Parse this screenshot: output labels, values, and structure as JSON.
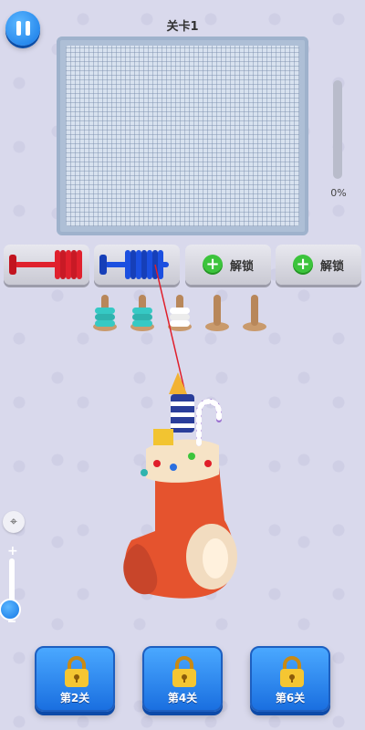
{
  "header": {
    "title": "关卡1"
  },
  "progress": {
    "percent": 0,
    "label": "0%"
  },
  "slots": [
    {
      "type": "spool",
      "color": "#e0212d"
    },
    {
      "type": "spool",
      "color": "#1b4fe0"
    },
    {
      "type": "locked",
      "label": "解锁"
    },
    {
      "type": "locked",
      "label": "解锁"
    }
  ],
  "peg_ring_colors": [
    "#36c9c4",
    "#36c9c4",
    "#ffffff",
    "#c99a6c",
    "#c99a6c"
  ],
  "level_buttons": [
    {
      "label": "第2关",
      "locked": true
    },
    {
      "label": "第4关",
      "locked": true
    },
    {
      "label": "第6关",
      "locked": true
    }
  ],
  "icons": {
    "pause": "pause-icon",
    "locate": "crosshair-icon",
    "lock": "padlock-icon",
    "plus": "plus-icon"
  }
}
